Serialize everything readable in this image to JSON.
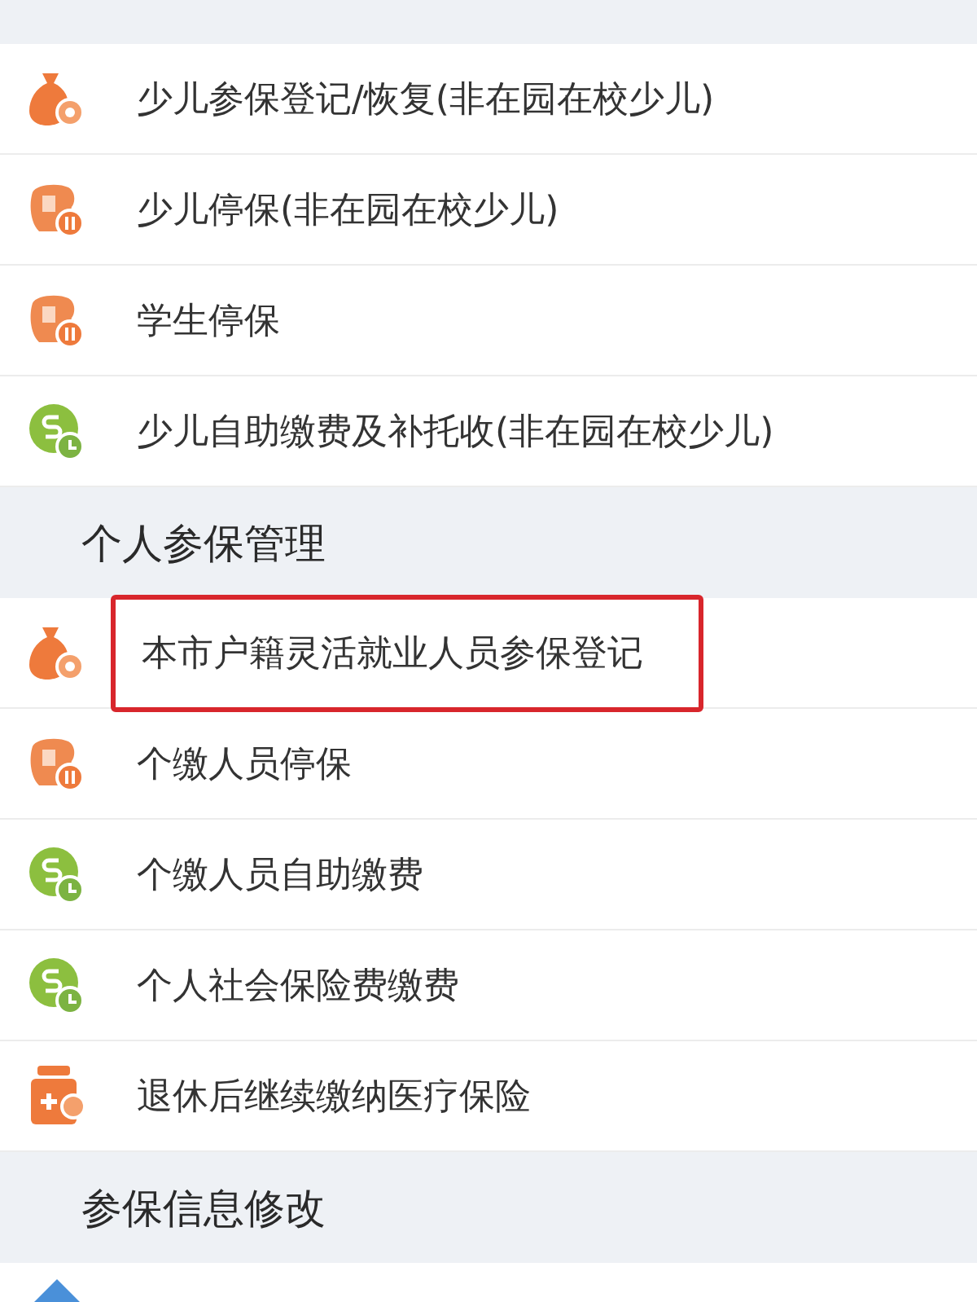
{
  "sections": [
    {
      "items": [
        {
          "kind": "bag",
          "label": "少儿参保登记/恢复(非在园在校少儿)",
          "highlighted": false
        },
        {
          "kind": "stop",
          "label": "少儿停保(非在园在校少儿)",
          "highlighted": false
        },
        {
          "kind": "stop",
          "label": "学生停保",
          "highlighted": false
        },
        {
          "kind": "pay",
          "label": "少儿自助缴费及补托收(非在园在校少儿)",
          "highlighted": false
        }
      ]
    },
    {
      "title": "个人参保管理",
      "items": [
        {
          "kind": "bag",
          "label": "本市户籍灵活就业人员参保登记",
          "highlighted": true
        },
        {
          "kind": "stop",
          "label": "个缴人员停保",
          "highlighted": false
        },
        {
          "kind": "pay",
          "label": "个缴人员自助缴费",
          "highlighted": false
        },
        {
          "kind": "pay",
          "label": "个人社会保险费缴费",
          "highlighted": false
        },
        {
          "kind": "medical",
          "label": "退休后继续缴纳医疗保险",
          "highlighted": false
        }
      ]
    },
    {
      "title": "参保信息修改",
      "items": [
        {
          "kind": "diamond"
        }
      ]
    }
  ]
}
